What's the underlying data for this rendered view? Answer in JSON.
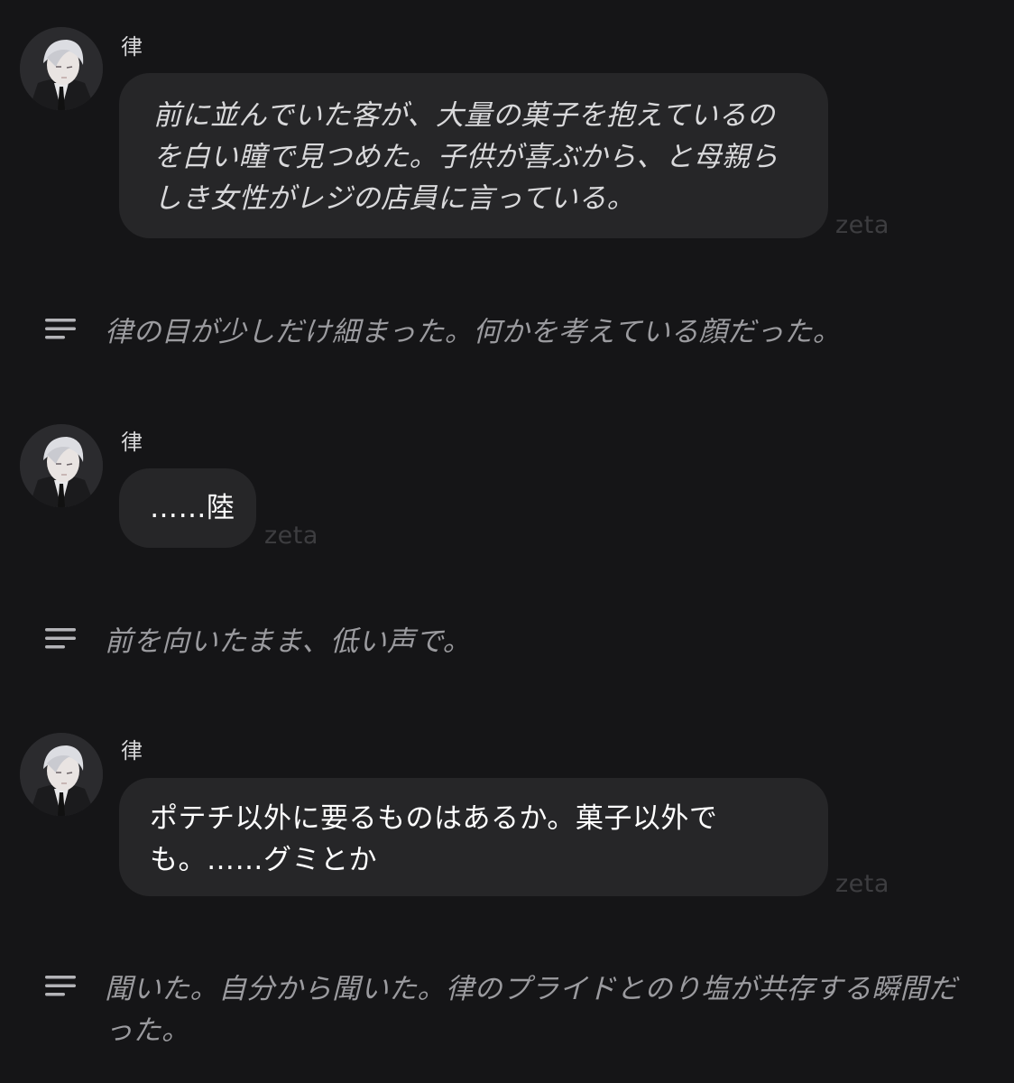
{
  "messages": [
    {
      "sender": "律",
      "text": "前に並んでいた客が、大量の菓子を抱えているのを白い瞳で見つめた。子供が喜ぶから、と母親らしき女性がレジの店員に言っている。",
      "watermark": "zeta"
    },
    {
      "sender": "律",
      "text": "……陸",
      "watermark": "zeta"
    },
    {
      "sender": "律",
      "text": "ポテチ以外に要るものはあるか。菓子以外でも。……グミとか",
      "watermark": "zeta"
    }
  ],
  "narrations": [
    {
      "icon": "narration-lines-icon",
      "text": "律の目が少しだけ細まった。何かを考えている顔だった。"
    },
    {
      "icon": "narration-lines-icon",
      "text": "前を向いたまま、低い声で。"
    },
    {
      "icon": "narration-lines-icon",
      "text": "聞いた。自分から聞いた。律のプライドとのり塩が共存する瞬間だった。"
    }
  ],
  "colors": {
    "background": "#151517",
    "bubble": "#262628",
    "narration_text": "#9b9b9f",
    "watermark": "#3d3d40"
  }
}
